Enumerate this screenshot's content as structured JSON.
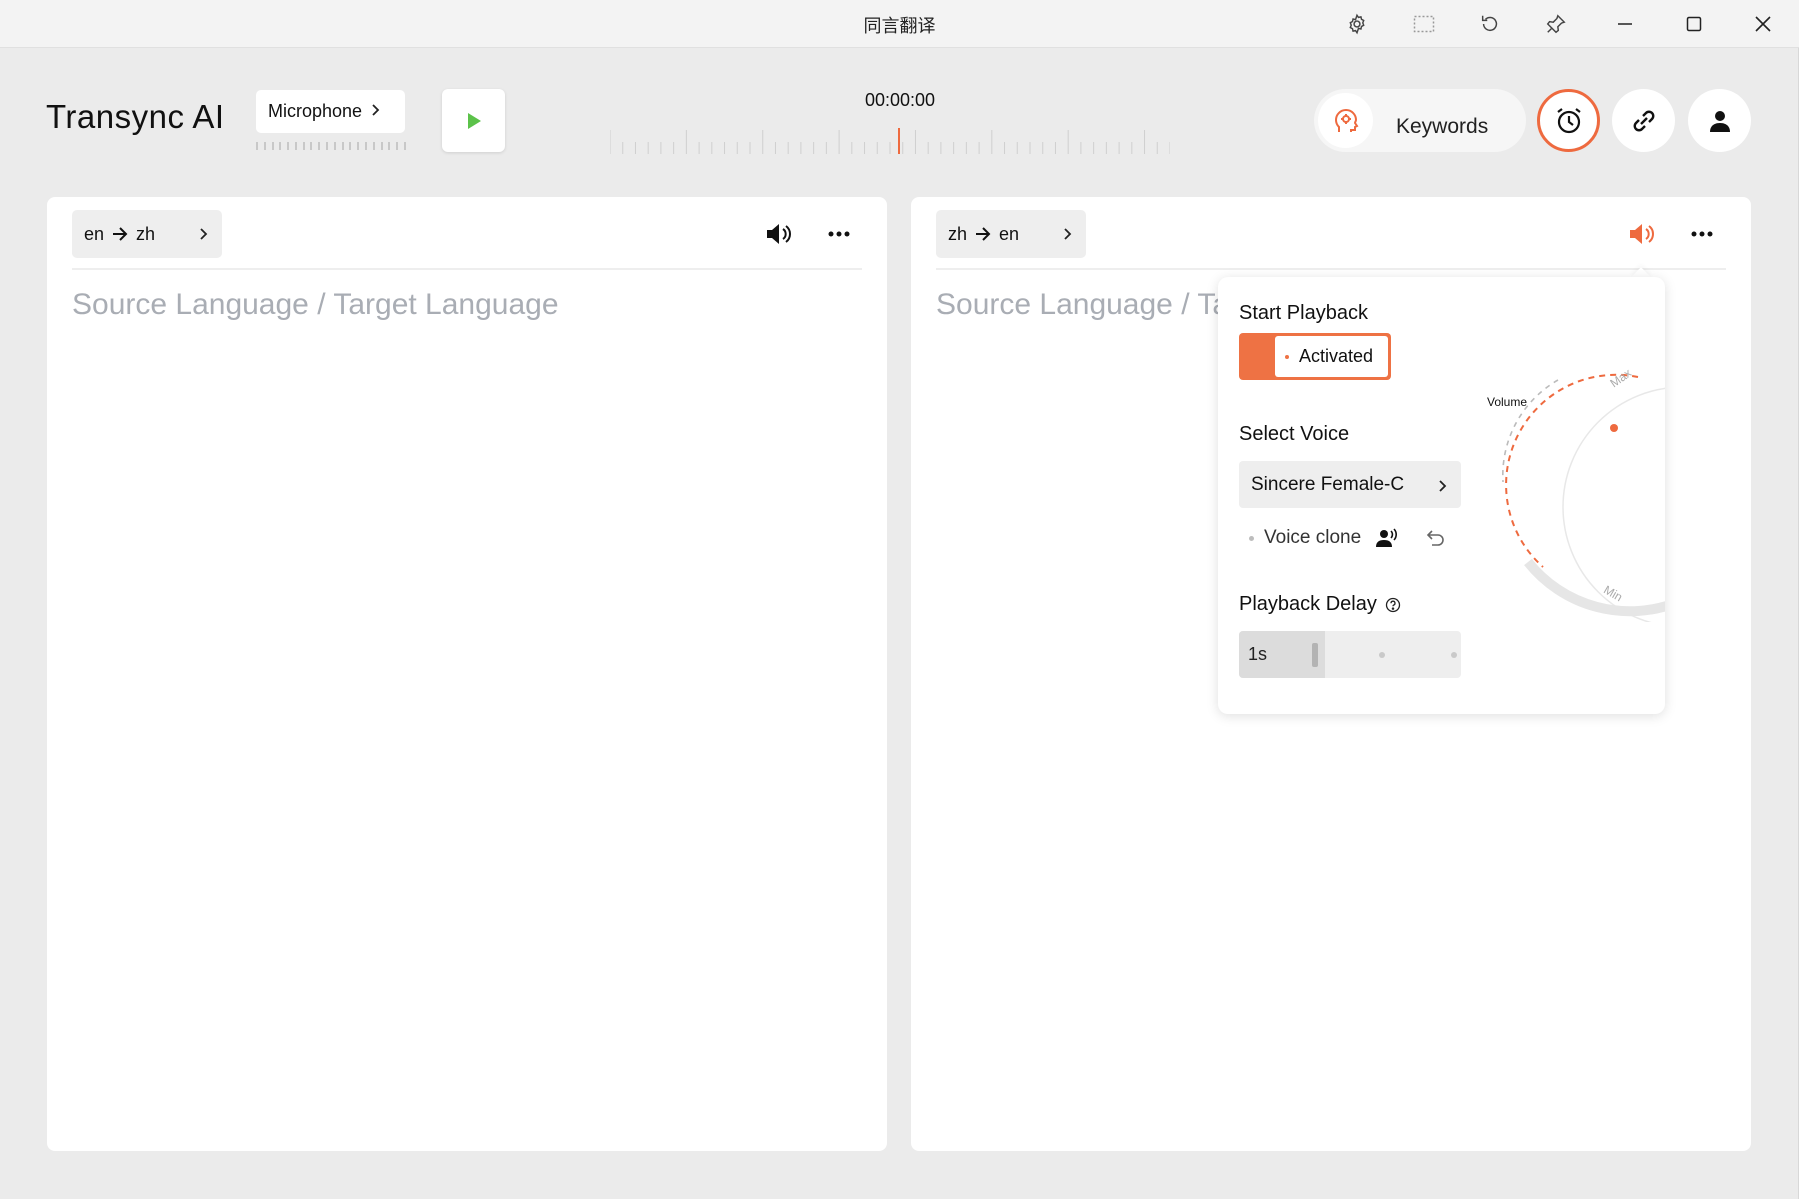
{
  "window": {
    "title": "同言翻译",
    "controls": [
      "settings-icon",
      "window-mode-icon",
      "refresh-icon",
      "pin-icon",
      "minimize-icon",
      "maximize-icon",
      "close-icon"
    ]
  },
  "header": {
    "app_name": "Transync AI",
    "input_source_label": "Microphone",
    "timer": "00:00:00",
    "keywords_label": "Keywords"
  },
  "colors": {
    "accent": "#ee6a3f",
    "play_green": "#5cc24a",
    "placeholder": "#a9adb4"
  },
  "left_panel": {
    "source_lang": "en",
    "target_lang": "zh",
    "placeholder": "Source Language / Target Language"
  },
  "right_panel": {
    "source_lang": "zh",
    "target_lang": "en",
    "placeholder": "Source Language / Ta"
  },
  "playback_popover": {
    "start_playback_heading": "Start Playback",
    "toggle_label": "Activated",
    "select_voice_heading": "Select Voice",
    "voice_value": "Sincere Female-C",
    "voice_clone_label": "Voice clone",
    "playback_delay_heading": "Playback Delay",
    "delay_value": "1s",
    "volume_label": "Volume",
    "volume_max_label": "Max",
    "volume_min_label": "Min"
  }
}
